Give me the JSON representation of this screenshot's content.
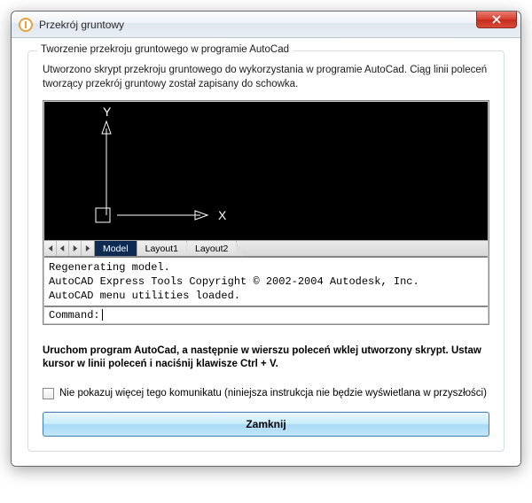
{
  "window": {
    "title": "Przekrój gruntowy"
  },
  "group": {
    "title": "Tworzenie przekroju gruntowego w programie AutoCad",
    "description": "Utworzono skrypt przekroju gruntowego do wykorzystania w programie AutoCad. Ciąg linii poleceń tworzący przekrój gruntowy został zapisany do schowka."
  },
  "cad": {
    "axis_y": "Y",
    "axis_x": "X",
    "tabs": {
      "model": "Model",
      "layout1": "Layout1",
      "layout2": "Layout2"
    },
    "terminal": "Regenerating model.\nAutoCAD Express Tools Copyright © 2002-2004 Autodesk, Inc.\nAutoCAD menu utilities loaded.",
    "command_prompt": "Command: "
  },
  "instruction": "Uruchom program AutoCad, a następnie w wierszu poleceń wklej utworzony skrypt. Ustaw kursor w linii poleceń i naciśnij klawisze Ctrl + V.",
  "checkbox_label": "Nie pokazuj więcej tego komunikatu (niniejsza instrukcja nie będzie wyświetlana w przyszłości)",
  "close_button": "Zamknij"
}
